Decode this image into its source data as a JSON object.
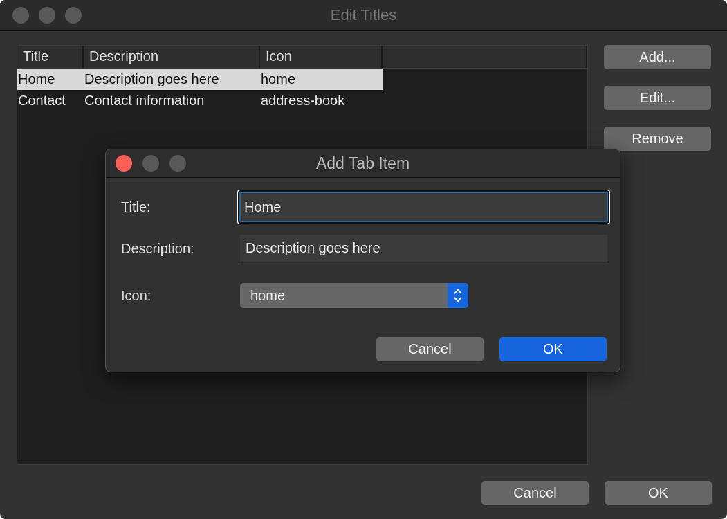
{
  "window": {
    "title": "Edit Titles",
    "active": false
  },
  "table": {
    "columns": [
      "Title",
      "Description",
      "Icon"
    ],
    "rows": [
      {
        "cells": [
          "Home",
          "Description goes here",
          "home"
        ],
        "selected": true
      },
      {
        "cells": [
          "Contact",
          "Contact information",
          "address-book"
        ],
        "selected": false
      }
    ]
  },
  "side_buttons": [
    "Add...",
    "Edit...",
    "Remove"
  ],
  "footer_buttons": [
    "Cancel",
    "OK"
  ],
  "dialog": {
    "title": "Add Tab Item",
    "active": true,
    "fields": [
      {
        "label": "Title:",
        "kind": "text",
        "value": "Home",
        "focused": true
      },
      {
        "label": "Description:",
        "kind": "text",
        "value": "Description goes here",
        "focused": false
      },
      {
        "label": "Icon:",
        "kind": "select",
        "value": "home"
      }
    ],
    "buttons": [
      {
        "label": "Cancel",
        "kind": "normal"
      },
      {
        "label": "OK",
        "kind": "default"
      }
    ]
  }
}
